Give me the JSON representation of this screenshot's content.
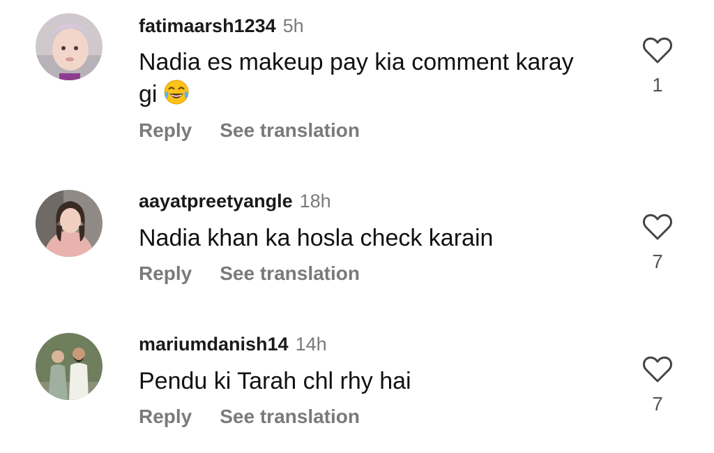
{
  "comments": [
    {
      "username": "fatimaarsh1234",
      "time": "5h",
      "text": "Nadia es makeup pay kia comment karay gi",
      "has_emoji": "face-with-tears-of-joy-icon",
      "reply_label": "Reply",
      "translate_label": "See translation",
      "likes": "1",
      "like_icon": "heart-outline-icon"
    },
    {
      "username": "aayatpreetyangle",
      "time": "18h",
      "text": "Nadia khan ka hosla check karain",
      "reply_label": "Reply",
      "translate_label": "See translation",
      "likes": "7",
      "like_icon": "heart-outline-icon"
    },
    {
      "username": "mariumdanish14",
      "time": "14h",
      "text": "Pendu ki Tarah chl rhy hai",
      "reply_label": "Reply",
      "translate_label": "See translation",
      "likes": "7",
      "like_icon": "heart-outline-icon"
    }
  ]
}
